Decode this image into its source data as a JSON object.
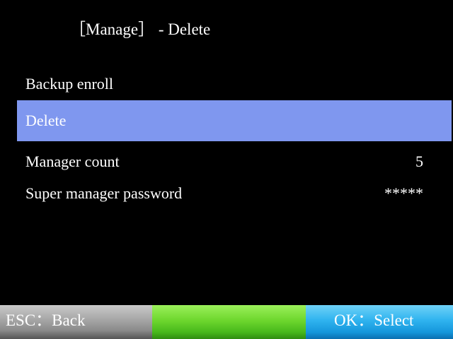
{
  "header": {
    "title": "［Manage］ - Delete"
  },
  "menu": {
    "items": [
      {
        "label": "Backup enroll",
        "value": "",
        "selected": false
      },
      {
        "label": "Delete",
        "value": "",
        "selected": true
      },
      {
        "label": "Manager count",
        "value": "5",
        "selected": false
      },
      {
        "label": "Super manager password",
        "value": "*****",
        "selected": false
      }
    ]
  },
  "softkeys": {
    "left_label": "ESC：Back",
    "middle_label": "",
    "right_label": "OK：Select"
  },
  "colors": {
    "background": "#000000",
    "selection": "#7f97ef",
    "softkey_left": "#a9a9a9",
    "softkey_middle": "#6ed72e",
    "softkey_right": "#2fb3ef"
  }
}
